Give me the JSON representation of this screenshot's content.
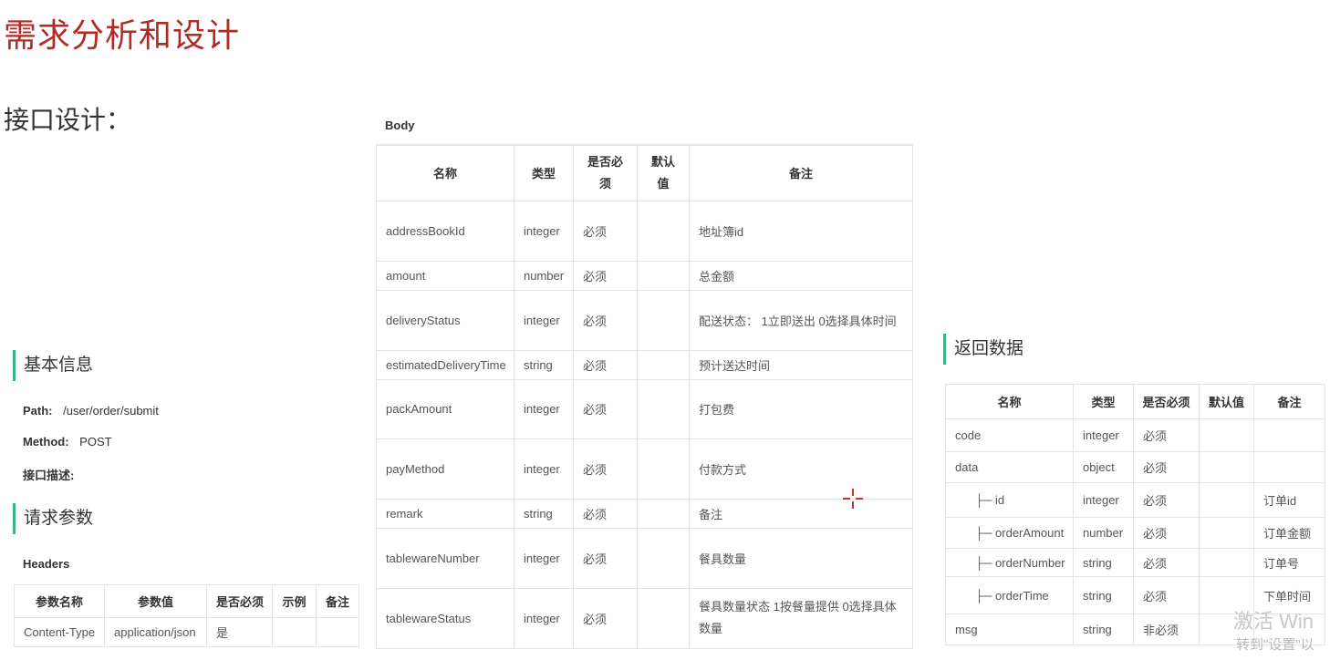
{
  "page": {
    "title": "需求分析和设计",
    "section": "接口设计："
  },
  "basic_info": {
    "heading": "基本信息",
    "path_label": "Path:",
    "path_value": "/user/order/submit",
    "method_label": "Method:",
    "method_value": "POST",
    "desc_label": "接口描述:"
  },
  "request_params": {
    "heading": "请求参数",
    "headers_label": "Headers",
    "columns": [
      "参数名称",
      "参数值",
      "是否必须",
      "示例",
      "备注"
    ],
    "rows": [
      [
        "Content-Type",
        "application/json",
        "是",
        "",
        ""
      ]
    ]
  },
  "body": {
    "label": "Body",
    "columns": [
      "名称",
      "类型",
      "是否必须",
      "默认值",
      "备注"
    ],
    "rows": [
      [
        "addressBookId",
        "integer",
        "必须",
        "",
        "地址簿id"
      ],
      [
        "amount",
        "number",
        "必须",
        "",
        "总金额"
      ],
      [
        "deliveryStatus",
        "integer",
        "必须",
        "",
        "配送状态： 1立即送出 0选择具体时间"
      ],
      [
        "estimatedDeliveryTime",
        "string",
        "必须",
        "",
        "预计送达时间"
      ],
      [
        "packAmount",
        "integer",
        "必须",
        "",
        "打包费"
      ],
      [
        "payMethod",
        "integer",
        "必须",
        "",
        "付款方式"
      ],
      [
        "remark",
        "string",
        "必须",
        "",
        "备注"
      ],
      [
        "tablewareNumber",
        "integer",
        "必须",
        "",
        "餐具数量"
      ],
      [
        "tablewareStatus",
        "integer",
        "必须",
        "",
        "餐具数量状态 1按餐量提供 0选择具体数量"
      ]
    ]
  },
  "response": {
    "heading": "返回数据",
    "columns": [
      "名称",
      "类型",
      "是否必须",
      "默认值",
      "备注"
    ],
    "rows": [
      [
        "code",
        "integer",
        "必须",
        "",
        ""
      ],
      [
        "data",
        "object",
        "必须",
        "",
        ""
      ],
      [
        "├─ id",
        "integer",
        "必须",
        "",
        "订单id"
      ],
      [
        "├─ orderAmount",
        "number",
        "必须",
        "",
        "订单金额"
      ],
      [
        "├─ orderNumber",
        "string",
        "必须",
        "",
        "订单号"
      ],
      [
        "├─ orderTime",
        "string",
        "必须",
        "",
        "下单时间"
      ],
      [
        "msg",
        "string",
        "非必须",
        "",
        ""
      ]
    ]
  },
  "watermark": {
    "line1": "激活 Win",
    "line2": "转到\"设置\"以"
  },
  "colors": {
    "title": "#b22a25",
    "accent_bar": "#3cb48a",
    "cursor": "#c8322a"
  }
}
